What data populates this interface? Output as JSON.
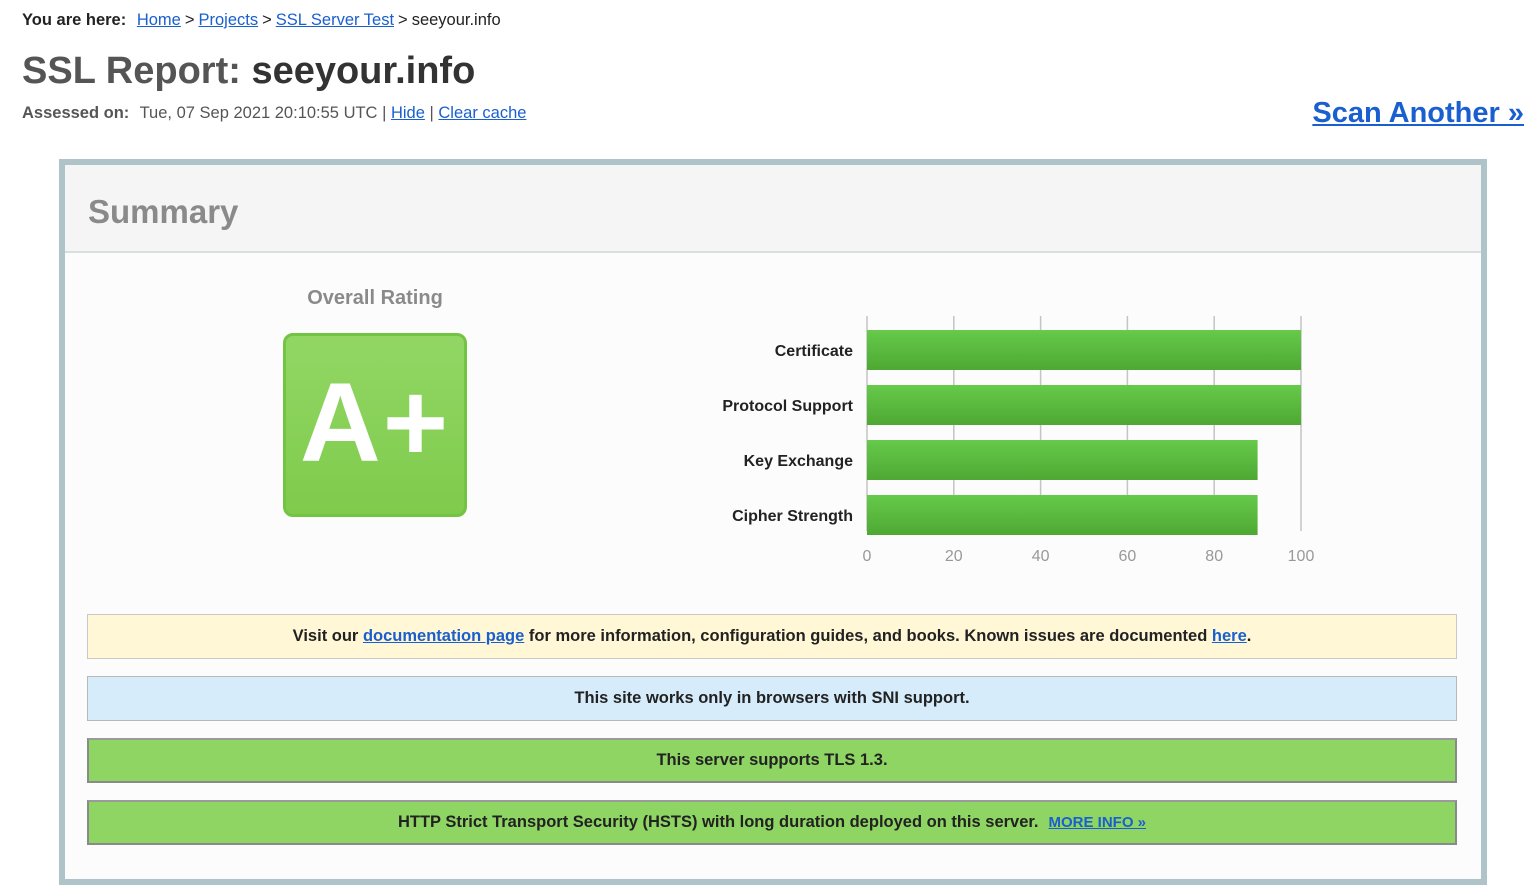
{
  "breadcrumb": {
    "label": "You are here:",
    "items": [
      "Home",
      "Projects",
      "SSL Server Test"
    ],
    "current": "seeyour.info",
    "separator": ">"
  },
  "header": {
    "title_prefix": "SSL Report:",
    "title_host": "seeyour.info",
    "assessed_label": "Assessed on:",
    "assessed_value": "Tue, 07 Sep 2021 20:10:55 UTC",
    "pipe": "|",
    "hide_link": "Hide",
    "clear_cache_link": "Clear cache",
    "scan_another": "Scan Another »"
  },
  "summary": {
    "title": "Summary",
    "overall_label": "Overall Rating",
    "grade": "A+",
    "grade_color": "#80cb4e"
  },
  "chart_data": {
    "type": "bar",
    "orientation": "horizontal",
    "categories": [
      "Certificate",
      "Protocol Support",
      "Key Exchange",
      "Cipher Strength"
    ],
    "values": [
      100,
      100,
      90,
      90
    ],
    "xlim": [
      0,
      100
    ],
    "xticks": [
      "0",
      "20",
      "40",
      "60",
      "80",
      "100"
    ],
    "grid": true,
    "bar_color": "#5cbf3f",
    "title": "",
    "xlabel": "",
    "ylabel": ""
  },
  "notices": {
    "doc": {
      "prefix": "Visit our",
      "link1": "documentation page",
      "middle": "for more information, configuration guides, and books. Known issues are documented",
      "link2": "here",
      "suffix": "."
    },
    "sni": "This site works only in browsers with SNI support.",
    "tls13": "This server supports TLS 1.3.",
    "hsts": "HTTP Strict Transport Security (HSTS) with long duration deployed on this server.",
    "hsts_more": "MORE INFO »"
  }
}
